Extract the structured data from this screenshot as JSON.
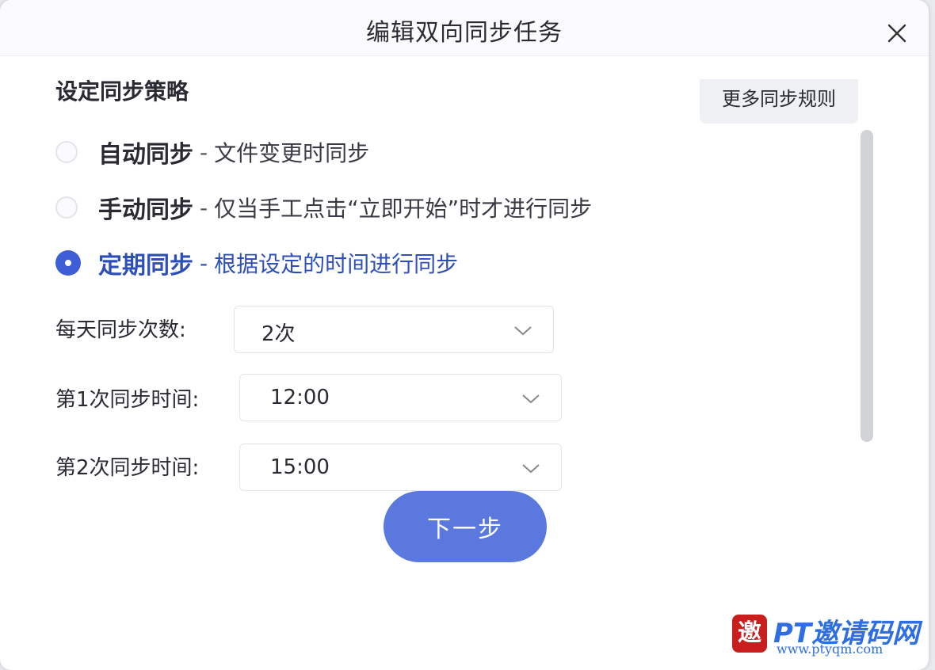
{
  "dialog": {
    "title": "编辑双向同步任务"
  },
  "strategy": {
    "section_title": "设定同步策略",
    "more_rules_label": "更多同步规则",
    "options": [
      {
        "name": "自动同步",
        "separator": "-",
        "desc": "文件变更时同步",
        "checked": false
      },
      {
        "name": "手动同步",
        "separator": "-",
        "desc": "仅当手工点击“立即开始”时才进行同步",
        "checked": false
      },
      {
        "name": "定期同步",
        "separator": "-",
        "desc": "根据设定的时间进行同步",
        "checked": true
      }
    ]
  },
  "schedule": {
    "times_per_day_label": "每天同步次数:",
    "times_per_day_value": "2次",
    "first_time_label": "第1次同步时间:",
    "first_time_value": "12:00",
    "second_time_label": "第2次同步时间:",
    "second_time_value": "15:00"
  },
  "footer": {
    "next_label": "下一步"
  },
  "watermark": {
    "seal_char": "邀",
    "brand": "PT邀请码网",
    "url": "www.ptyqm.com"
  },
  "colors": {
    "accent": "#3d5ed6",
    "button": "#5b78df",
    "watermark": "#2f6ee0"
  },
  "icons": {
    "close": "close-icon",
    "chevron": "chevron-down-icon"
  }
}
